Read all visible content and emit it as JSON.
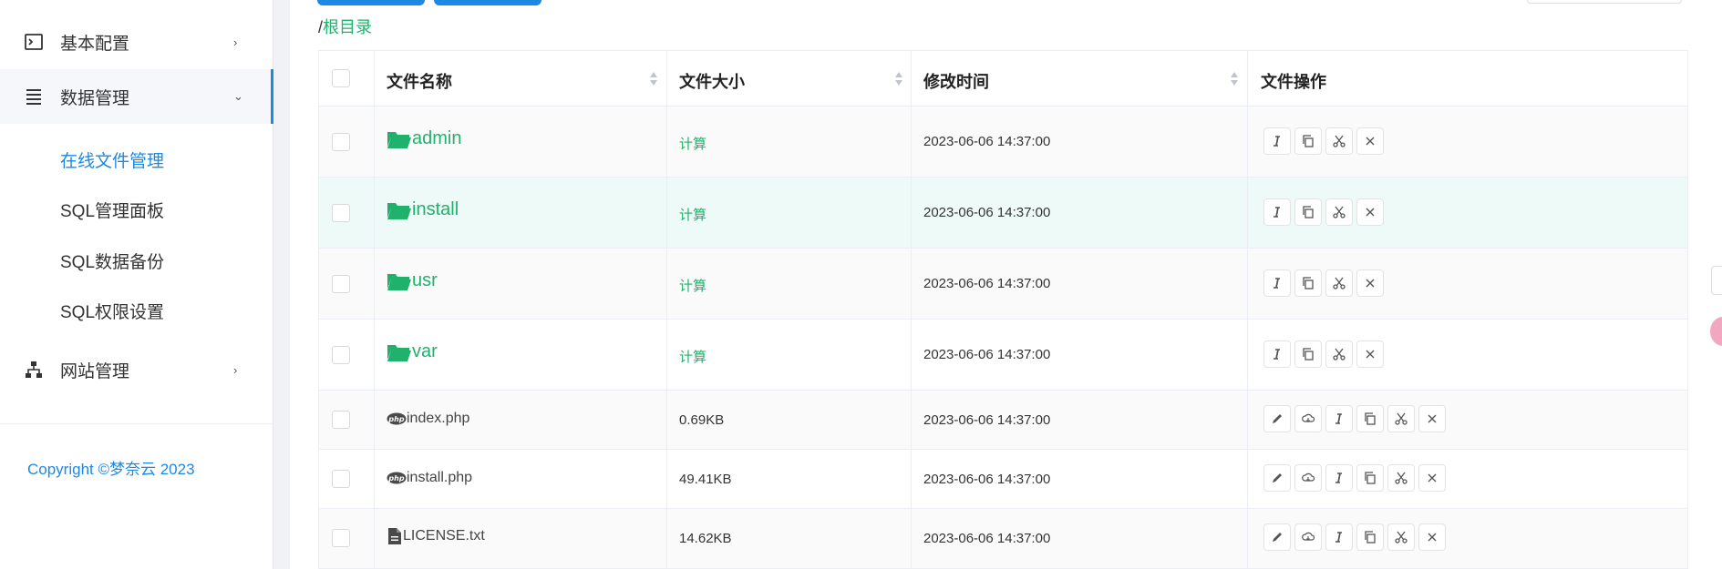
{
  "sidebar": {
    "items": [
      {
        "label": "基本配置",
        "icon": "terminal-icon"
      },
      {
        "label": "数据管理",
        "icon": "list-icon"
      },
      {
        "label": "网站管理",
        "icon": "sitemap-icon"
      }
    ],
    "submenu": [
      "在线文件管理",
      "SQL管理面板",
      "SQL数据备份",
      "SQL权限设置"
    ],
    "copyright": "Copyright ©梦奈云 2023"
  },
  "breadcrumb": {
    "sep": "/",
    "root": "根目录"
  },
  "table": {
    "headers": [
      "文件名称",
      "文件大小",
      "修改时间",
      "文件操作"
    ],
    "rows": [
      {
        "type": "folder",
        "name": "admin",
        "size": "计算",
        "time": "2023-06-06 14:37:00"
      },
      {
        "type": "folder",
        "name": "install",
        "size": "计算",
        "time": "2023-06-06 14:37:00"
      },
      {
        "type": "folder",
        "name": "usr",
        "size": "计算",
        "time": "2023-06-06 14:37:00"
      },
      {
        "type": "folder",
        "name": "var",
        "size": "计算",
        "time": "2023-06-06 14:37:00"
      },
      {
        "type": "php",
        "name": "index.php",
        "size": "0.69KB",
        "time": "2023-06-06 14:37:00"
      },
      {
        "type": "php",
        "name": "install.php",
        "size": "49.41KB",
        "time": "2023-06-06 14:37:00"
      },
      {
        "type": "txt",
        "name": "LICENSE.txt",
        "size": "14.62KB",
        "time": "2023-06-06 14:37:00"
      }
    ],
    "folder_actions": [
      "rename-icon",
      "copy-icon",
      "cut-icon",
      "delete-icon"
    ],
    "file_actions": [
      "edit-icon",
      "download-icon",
      "rename-icon",
      "copy-icon",
      "cut-icon",
      "delete-icon"
    ]
  },
  "colors": {
    "accent": "#1e88e5",
    "link": "#20b26c",
    "hover_row": "#eefaf7"
  }
}
